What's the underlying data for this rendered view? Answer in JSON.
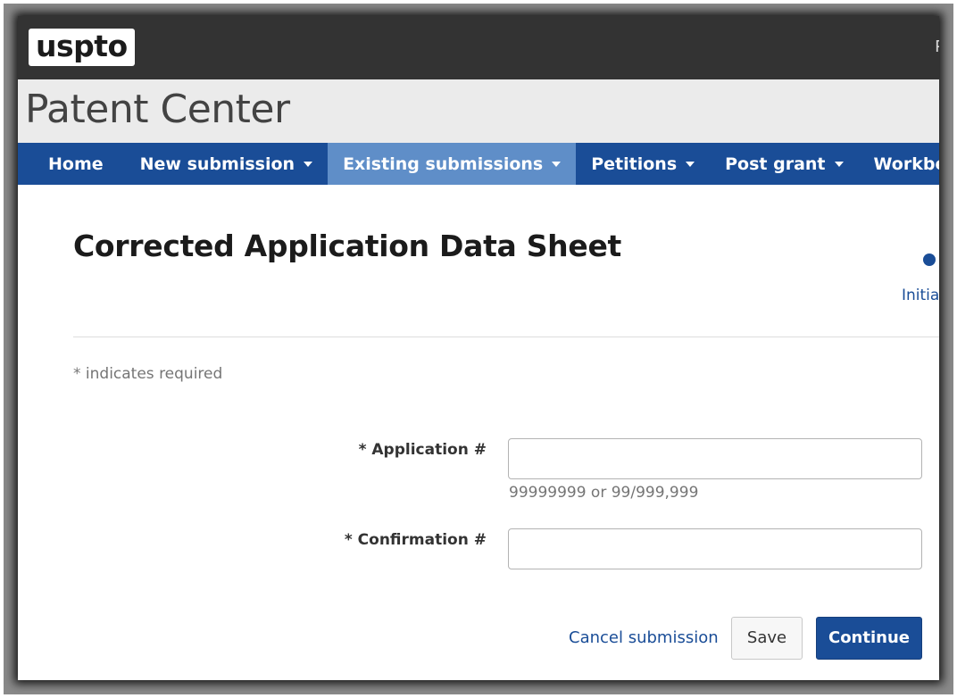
{
  "header": {
    "logo_text": "uspto",
    "right_text_clip": "P"
  },
  "app": {
    "title": "Patent Center"
  },
  "nav": {
    "items": [
      {
        "label": "Home",
        "dropdown": false
      },
      {
        "label": "New submission",
        "dropdown": true
      },
      {
        "label": "Existing submissions",
        "dropdown": true,
        "active": true
      },
      {
        "label": "Petitions",
        "dropdown": true
      },
      {
        "label": "Post grant",
        "dropdown": true
      },
      {
        "label": "Workbench",
        "dropdown": true
      }
    ]
  },
  "page": {
    "title": "Corrected Application Data Sheet",
    "step_label": "Initia",
    "required_note": "* indicates required"
  },
  "form": {
    "application_label": "* Application #",
    "application_value": "",
    "application_hint": "99999999 or 99/999,999",
    "confirmation_label": "* Confirmation #",
    "confirmation_value": ""
  },
  "actions": {
    "cancel_label": "Cancel submission",
    "save_label": "Save",
    "continue_label": "Continue"
  },
  "colors": {
    "nav_bg": "#1a4d97",
    "nav_active_bg": "#5f8ec8",
    "topbar_bg": "#333333",
    "titlebar_bg": "#ebebeb",
    "primary_button": "#1a4d97",
    "link": "#1a4d97"
  }
}
